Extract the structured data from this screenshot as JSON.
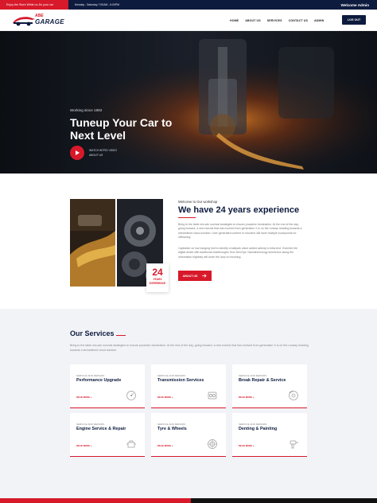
{
  "topbar": {
    "promo": "Enjoy the Store While no-So your car",
    "hours": "Monday - Saturday 7:00AM - 6:00PM",
    "welcome": "Welcome Admin"
  },
  "header": {
    "logo_top": "ABE",
    "logo_main": "GARAGE",
    "nav": [
      "HOME",
      "ABOUT US",
      "SERVICES",
      "CONTACT US",
      "ADMIN"
    ],
    "logout": "LOG OUT"
  },
  "hero": {
    "since": "Working since 1992",
    "title": "Tuneup Your Car to Next Level",
    "watch": "WATCH INTRO VIDEO ABOUT US"
  },
  "about": {
    "welcome": "Welcome to Our workshop",
    "heading": "We have 24 years experience",
    "para1": "Bring to the table win-win survival strategies to ensure proactive domination. At the end of the day, going forward, a new normal that has evolved from generation X is on the runway heading towards a streamlined cloud solution. User generated content in real-time will have multiple touchpoints for offshoring.",
    "para2": "Capitalize on low hanging fruit to identify a ballpark value added activity to beta test. Override the digital divide with additional clickthroughs from DevOps. Nanotechnology immersion along the information highway will close the loop on focusing.",
    "badge_num": "24",
    "badge_label": "YEARS EXPERIENCE",
    "button": "ABOUT US"
  },
  "services": {
    "heading": "Our Services",
    "intro": "Bring to the table win-win survival strategies to ensure proactive domination. At the end of the day, going forward, a new normal that has evolved from generation X is on the runway heading towards a streamlined cloud solution.",
    "cards": [
      {
        "kicker": "SERVICE AND REPAIRS",
        "title": "Performance Upgrade",
        "more": "READ MORE »",
        "icon": "gauge-icon"
      },
      {
        "kicker": "SERVICE AND REPAIRS",
        "title": "Transmission Services",
        "more": "READ MORE »",
        "icon": "gearbox-icon"
      },
      {
        "kicker": "SERVICE AND REPAIRS",
        "title": "Break Repair & Service",
        "more": "READ MORE »",
        "icon": "brake-disc-icon"
      },
      {
        "kicker": "SERVICE AND REPAIRS",
        "title": "Engine Service & Repair",
        "more": "READ MORE »",
        "icon": "engine-icon"
      },
      {
        "kicker": "SERVICE AND REPAIRS",
        "title": "Tyre & Wheels",
        "more": "READ MORE »",
        "icon": "wheel-icon"
      },
      {
        "kicker": "SERVICE AND REPAIRS",
        "title": "Denting & Painting",
        "more": "READ MORE »",
        "icon": "spray-gun-icon"
      }
    ]
  },
  "colors": {
    "accent": "#d7192a",
    "navy": "#0d1b3e",
    "services_bg": "#f2f3f7"
  }
}
